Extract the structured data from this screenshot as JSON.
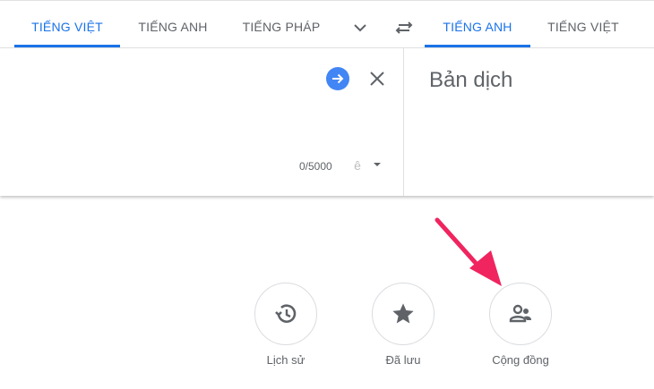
{
  "source_tabs": [
    "TIẾNG VIỆT",
    "TIẾNG ANH",
    "TIẾNG PHÁP"
  ],
  "target_tabs": [
    "TIẾNG ANH",
    "TIẾNG VIỆT"
  ],
  "source": {
    "char_count": "0/5000"
  },
  "target": {
    "placeholder": "Bản dịch"
  },
  "bottom": {
    "history": "Lịch sử",
    "saved": "Đã lưu",
    "community": "Cộng đồng"
  },
  "colors": {
    "accent": "#1a73e8",
    "arrow": "#f0245f",
    "go_button": "#4285f4"
  },
  "icons": [
    "chevron-down-icon",
    "swap-icon",
    "arrow-right-icon",
    "close-icon",
    "ime-icon",
    "history-icon",
    "star-icon",
    "community-icon"
  ]
}
